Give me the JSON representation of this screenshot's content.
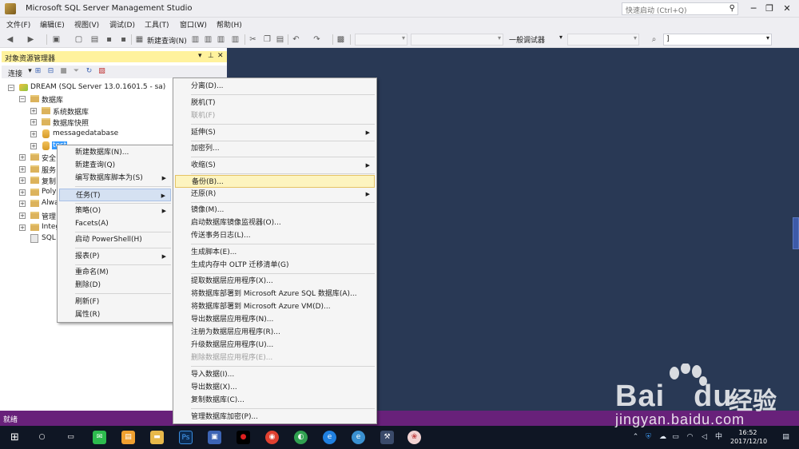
{
  "window": {
    "title": "Microsoft SQL Server Management Studio",
    "quick_launch_placeholder": "快速启动 (Ctrl+Q)",
    "minimize": "─",
    "restore": "❐",
    "close": "✕"
  },
  "menubar": [
    "文件(F)",
    "编辑(E)",
    "视图(V)",
    "调试(D)",
    "工具(T)",
    "窗口(W)",
    "帮助(H)"
  ],
  "toolbar": {
    "new_query": "新建查询(N)",
    "debugger_combo": "一般调试器",
    "search_combo": "]"
  },
  "object_explorer": {
    "title": "对象资源管理器",
    "connect": "连接",
    "tree": {
      "server": "DREAM (SQL Server 13.0.1601.5 - sa)",
      "databases": "数据库",
      "system_databases": "系统数据库",
      "snapshots": "数据库快照",
      "messagedatabase": "messagedatabase",
      "selected_db": "test",
      "security": "安全",
      "server_objects": "服务",
      "replication": "复制",
      "polybase": "Poly",
      "always_on": "Alwa",
      "management": "管理",
      "integration": "Integ",
      "sql_agent": "SQL"
    }
  },
  "context_menu_db": [
    {
      "label": "新建数据库(N)...",
      "arrow": false
    },
    {
      "label": "新建查询(Q)",
      "arrow": false
    },
    {
      "label": "编写数据库脚本为(S)",
      "arrow": true
    },
    {
      "label": "任务(T)",
      "arrow": true,
      "highlighted": true
    },
    {
      "label": "策略(O)",
      "arrow": true
    },
    {
      "label": "Facets(A)",
      "arrow": false
    },
    {
      "label": "启动 PowerShell(H)",
      "arrow": false
    },
    {
      "label": "报表(P)",
      "arrow": true
    },
    {
      "label": "重命名(M)",
      "arrow": false
    },
    {
      "label": "删除(D)",
      "arrow": false
    },
    {
      "label": "刷新(F)",
      "arrow": false
    },
    {
      "label": "属性(R)",
      "arrow": false
    }
  ],
  "context_menu_tasks": [
    {
      "label": "分离(D)...",
      "arrow": false
    },
    {
      "label": "脱机(T)",
      "arrow": false
    },
    {
      "label": "联机(F)",
      "arrow": false,
      "disabled": true
    },
    {
      "label": "延伸(S)",
      "arrow": true
    },
    {
      "label": "加密列...",
      "arrow": false
    },
    {
      "label": "收缩(S)",
      "arrow": true
    },
    {
      "label": "备份(B)...",
      "arrow": false,
      "highlighted": true
    },
    {
      "label": "还原(R)",
      "arrow": true
    },
    {
      "label": "镜像(M)...",
      "arrow": false
    },
    {
      "label": "启动数据库镜像监视器(O)...",
      "arrow": false
    },
    {
      "label": "传送事务日志(L)...",
      "arrow": false
    },
    {
      "label": "生成脚本(E)...",
      "arrow": false
    },
    {
      "label": "生成内存中 OLTP 迁移清单(G)",
      "arrow": false
    },
    {
      "label": "提取数据层应用程序(X)...",
      "arrow": false
    },
    {
      "label": "将数据库部署到 Microsoft Azure SQL 数据库(A)...",
      "arrow": false
    },
    {
      "label": "将数据库部署到 Microsoft Azure VM(D)...",
      "arrow": false
    },
    {
      "label": "导出数据层应用程序(N)...",
      "arrow": false
    },
    {
      "label": "注册为数据层应用程序(R)...",
      "arrow": false
    },
    {
      "label": "升级数据层应用程序(U)...",
      "arrow": false
    },
    {
      "label": "删除数据层应用程序(E)...",
      "arrow": false,
      "disabled": true
    },
    {
      "label": "导入数据(I)...",
      "arrow": false
    },
    {
      "label": "导出数据(X)...",
      "arrow": false
    },
    {
      "label": "复制数据库(C)...",
      "arrow": false
    },
    {
      "label": "管理数据库加密(P)...",
      "arrow": false
    }
  ],
  "statusbar": {
    "text": "就绪"
  },
  "taskbar": {
    "time": "16:52",
    "date": "2017/12/10",
    "ime": "中"
  },
  "watermark": {
    "brand": "Bai",
    "brand2": "du",
    "brand_cn": "经验",
    "url": "jingyan.baidu.com"
  },
  "colors": {
    "status_bar": "#68217a",
    "main_bg": "#293955",
    "oe_title_bg": "#fff29d",
    "highlight": "#fdf4bf"
  }
}
